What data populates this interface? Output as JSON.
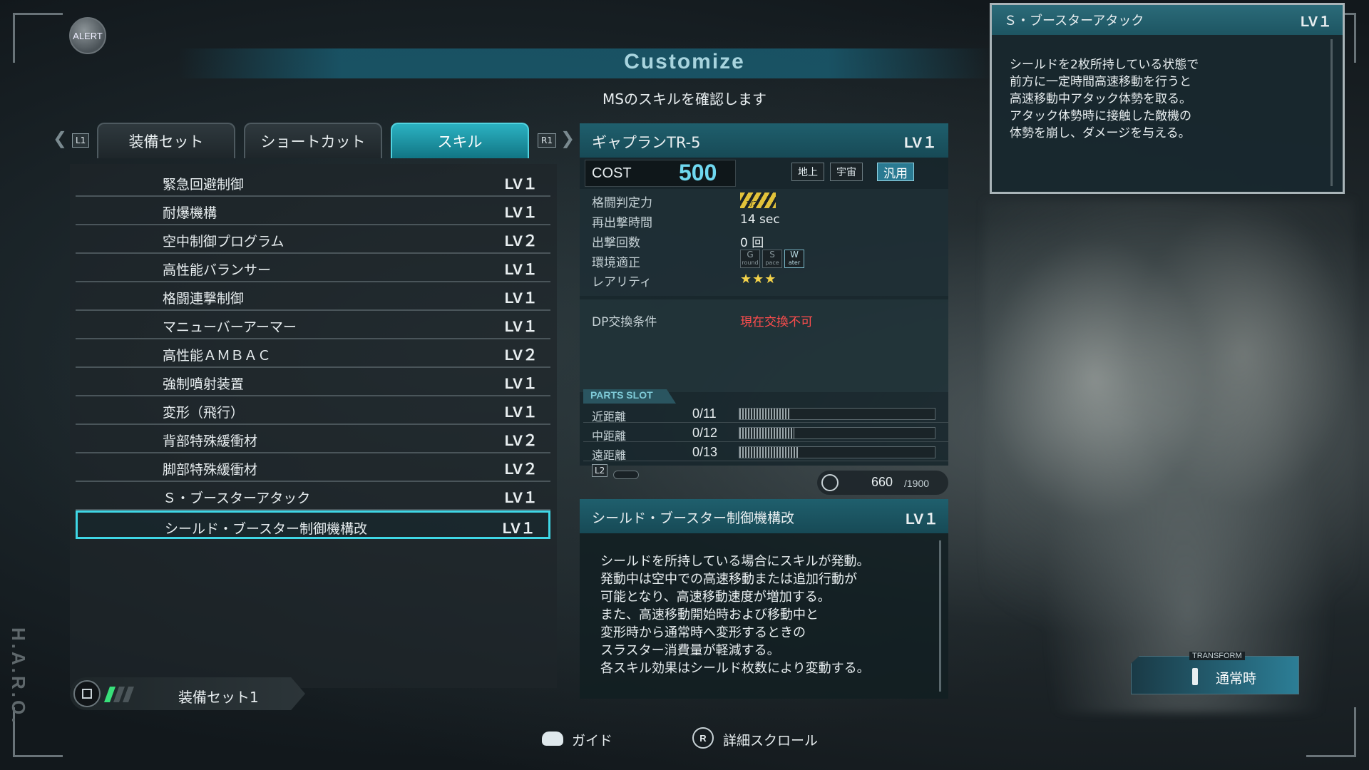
{
  "header": {
    "alert": "ALERT",
    "title": "Customize",
    "subtitle": "MSのスキルを確認します",
    "side_text": "H.A.R.O."
  },
  "tabs": {
    "left_button": "L1",
    "right_button": "R1",
    "items": [
      {
        "label": "装備セット",
        "active": false
      },
      {
        "label": "ショートカット",
        "active": false
      },
      {
        "label": "スキル",
        "active": true
      }
    ]
  },
  "skills": [
    {
      "name": "緊急回避制御",
      "level": "LV１"
    },
    {
      "name": "耐爆機構",
      "level": "LV１"
    },
    {
      "name": "空中制御プログラム",
      "level": "LV２"
    },
    {
      "name": "高性能バランサー",
      "level": "LV１"
    },
    {
      "name": "格闘連撃制御",
      "level": "LV１"
    },
    {
      "name": "マニューバーアーマー",
      "level": "LV１"
    },
    {
      "name": "高性能ＡＭＢＡＣ",
      "level": "LV２"
    },
    {
      "name": "強制噴射装置",
      "level": "LV１"
    },
    {
      "name": "変形（飛行）",
      "level": "LV１"
    },
    {
      "name": "背部特殊緩衝材",
      "level": "LV２"
    },
    {
      "name": "脚部特殊緩衝材",
      "level": "LV２"
    },
    {
      "name": "Ｓ・ブースターアタック",
      "level": "LV１"
    },
    {
      "name": "シールド・ブースター制御機構改",
      "level": "LV１",
      "selected": true
    }
  ],
  "loadout": {
    "label": "装備セット1",
    "active_stripes": 1,
    "total_stripes": 3
  },
  "ms": {
    "name": "ギャプランTR-5",
    "level": "LV１",
    "cost_label": "COST",
    "cost_value": "500",
    "env_buttons": [
      {
        "label": "地上",
        "active": false
      },
      {
        "label": "宇宙",
        "active": false
      },
      {
        "label": "汎用",
        "active": true
      }
    ],
    "stats": [
      {
        "label": "格闘判定力",
        "value": ""
      },
      {
        "label": "再出撃時間",
        "value": "14 sec"
      },
      {
        "label": "出撃回数",
        "value": "0 回"
      },
      {
        "label": "環境適正",
        "value": ""
      },
      {
        "label": "レアリティ",
        "value": "★★★"
      }
    ],
    "melee_rating": "1/2",
    "env_icons": [
      {
        "letter": "G",
        "sub": "round",
        "on": false
      },
      {
        "letter": "S",
        "sub": "pace",
        "on": false
      },
      {
        "letter": "W",
        "sub": "ater",
        "on": true
      }
    ],
    "dp_label": "DP交換条件",
    "dp_value": "現在交換不可"
  },
  "parts_slot": {
    "title": "PARTS SLOT",
    "rows": [
      {
        "label": "近距離",
        "count": "0/11",
        "capacity": 11
      },
      {
        "label": "中距離",
        "count": "0/12",
        "capacity": 12
      },
      {
        "label": "遠距離",
        "count": "0/13",
        "capacity": 13
      }
    ],
    "page_button": "L2",
    "capacity_value": "660",
    "capacity_max": "/1900"
  },
  "skill_detail": {
    "title": "シールド・ブースター制御機構改",
    "level": "LV１",
    "text": "シールドを所持している場合にスキルが発動。\n発動中は空中での高速移動または追加行動が\n可能となり、高速移動速度が増加する。\nまた、高速移動開始時および移動中と\n変形時から通常時へ変形するときの\nスラスター消費量が軽減する。\n各スキル効果はシールド枚数により変動する。"
  },
  "popup": {
    "title": "Ｓ・ブースターアタック",
    "level": "LV１",
    "text": "シールドを2枚所持している状態で\n前方に一定時間高速移動を行うと\n高速移動中アタック体勢を取る。\nアタック体勢時に接触した敵機の\n体勢を崩し、ダメージを与える。"
  },
  "transform": {
    "label": "TRANSFORM",
    "value": "通常時"
  },
  "footer": {
    "guide_label": "ガイド",
    "scroll_button": "R",
    "scroll_label": "詳細スクロール"
  },
  "colors": {
    "accent": "#3fd7e6",
    "cost": "#6fd8f0",
    "warning": "#ff4d4d",
    "star": "#f3d24a",
    "loadout_on": "#38e07a"
  }
}
